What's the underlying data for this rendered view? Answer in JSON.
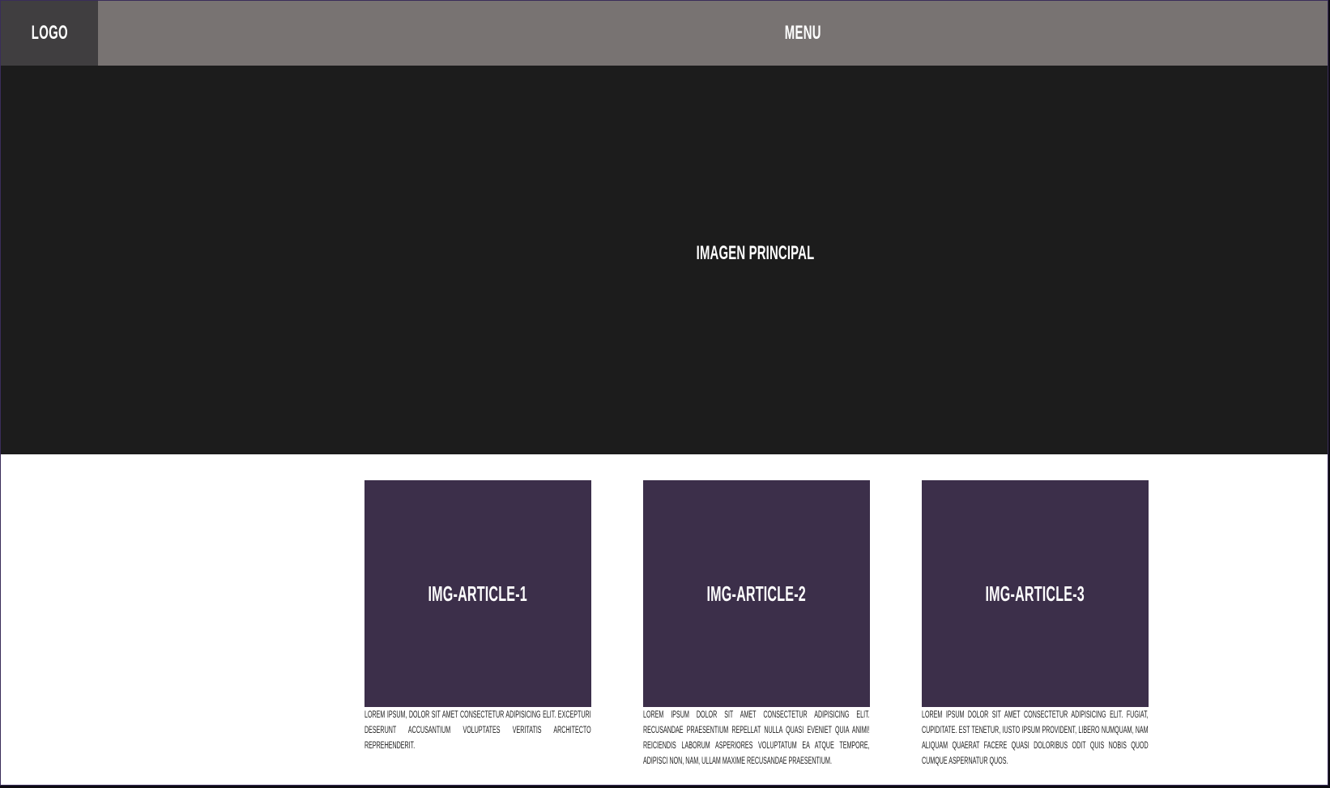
{
  "header": {
    "logo_label": "LOGO",
    "menu_label": "MENU"
  },
  "hero": {
    "label": "IMAGEN PRINCIPAL"
  },
  "articles": [
    {
      "image_label": "IMG-ARTICLE-1",
      "text": "LOREM IPSUM, DOLOR SIT AMET CONSECTETUR ADIPISICING ELIT. EXCEPTURI DESERUNT ACCUSANTIUM VOLUPTATES VERITATIS ARCHITECTO REPREHENDERIT."
    },
    {
      "image_label": "IMG-ARTICLE-2",
      "text": "LOREM IPSUM DOLOR SIT AMET CONSECTETUR ADIPISICING ELIT. RECUSANDAE PRAESENTIUM REPELLAT NULLA QUASI EVENIET QUIA ANIMI! REICIENDIS LABORUM ASPERIORES VOLUPTATUM EA ATQUE TEMPORE, ADIPISCI NON, NAM, ULLAM MAXIME RECUSANDAE PRAESENTIUM."
    },
    {
      "image_label": "IMG-ARTICLE-3",
      "text": "LOREM IPSUM DOLOR SIT AMET CONSECTETUR ADIPISICING ELIT. FUGIAT, CUPIDITATE. EST TENETUR, IUSTO IPSUM PROVIDENT, LIBERO NUMQUAM, NAM ALIQUAM QUAERAT FACERE QUASI DOLORIBUS ODIT QUIS NOBIS QUOD CUMQUE ASPERNATUR QUOS."
    }
  ],
  "colors": {
    "header_bg": "#787372",
    "logo_bg": "#403e40",
    "hero_bg": "#1c1c1c",
    "article_img_bg": "#3c2f4a",
    "page_bg": "#ffffff"
  }
}
